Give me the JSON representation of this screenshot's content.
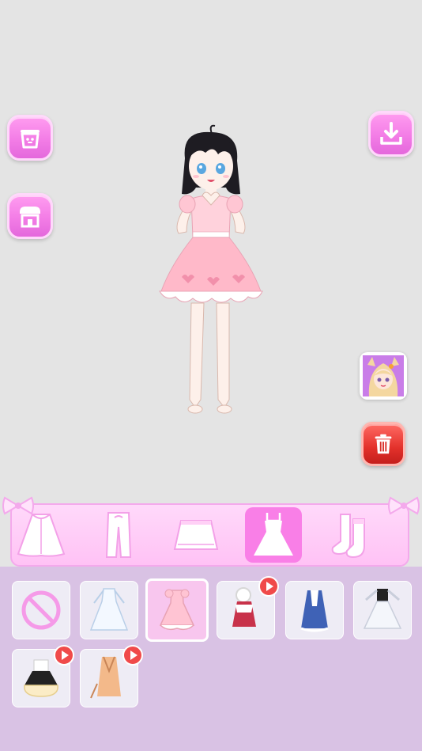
{
  "app": {
    "screen": "dress-up"
  },
  "left_buttons": [
    {
      "name": "wardrobe-button",
      "icon": "basket-icon"
    },
    {
      "name": "shop-button",
      "icon": "shop-icon"
    }
  ],
  "right_buttons": [
    {
      "name": "download-button",
      "icon": "download-icon"
    },
    {
      "name": "avatar-button",
      "icon": "character-avatar-icon"
    },
    {
      "name": "trash-button",
      "icon": "trash-icon"
    }
  ],
  "categories": [
    {
      "id": "outerwear",
      "icon": "cape-icon",
      "active": false
    },
    {
      "id": "pants",
      "icon": "pants-icon",
      "active": false
    },
    {
      "id": "skirt",
      "icon": "skirt-icon",
      "active": false
    },
    {
      "id": "dress",
      "icon": "dress-icon",
      "active": true
    },
    {
      "id": "socks",
      "icon": "socks-icon",
      "active": false
    }
  ],
  "items": [
    {
      "id": "none",
      "icon": "no-item-icon",
      "selected": false,
      "video_lock": false
    },
    {
      "id": "white-gown",
      "icon": "white-dress-icon",
      "selected": false,
      "video_lock": false
    },
    {
      "id": "pink-dress",
      "icon": "pink-dress-icon",
      "selected": true,
      "video_lock": false
    },
    {
      "id": "red-cape-dress",
      "icon": "red-dress-icon",
      "selected": false,
      "video_lock": true
    },
    {
      "id": "blue-coat",
      "icon": "blue-coat-icon",
      "selected": false,
      "video_lock": false
    },
    {
      "id": "black-white-dress",
      "icon": "black-dress-icon",
      "selected": false,
      "video_lock": false
    },
    {
      "id": "black-cream-dress",
      "icon": "cream-dress-icon",
      "selected": false,
      "video_lock": true
    },
    {
      "id": "peach-robe",
      "icon": "peach-robe-icon",
      "selected": false,
      "video_lock": true
    }
  ],
  "colors": {
    "accent": "#f37de6",
    "panel": "#d9c2e4",
    "stage": "#e4e4e4",
    "trash": "#e3312b"
  }
}
